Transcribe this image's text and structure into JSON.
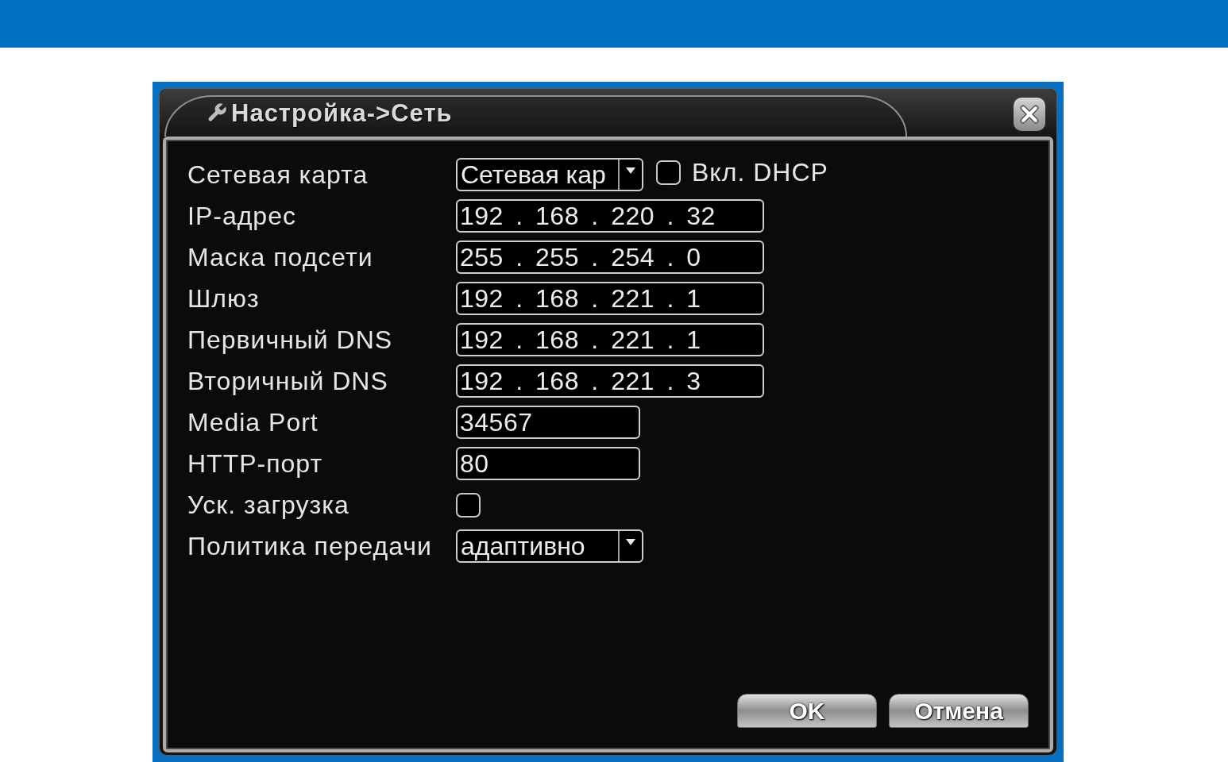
{
  "dialog": {
    "title": "Настройка->Сеть",
    "fields": [
      {
        "kind": "dropdown",
        "label": "Сетевая карта",
        "value": "Сетевая кар",
        "option": {
          "label": "Вкл. DHCP",
          "checked": false
        }
      },
      {
        "kind": "ip",
        "label": "IP-адрес",
        "value": "192 . 168 . 220 . 32"
      },
      {
        "kind": "ip",
        "label": "Маска подсети",
        "value": "255 . 255 . 254 . 0"
      },
      {
        "kind": "ip",
        "label": "Шлюз",
        "value": "192 . 168 . 221 . 1"
      },
      {
        "kind": "ip",
        "label": "Первичный DNS",
        "value": "192 . 168 . 221 . 1"
      },
      {
        "kind": "ip",
        "label": "Вторичный DNS",
        "value": "192 . 168 . 221 . 3"
      },
      {
        "kind": "text",
        "label": "Media Port",
        "value": "34567"
      },
      {
        "kind": "text",
        "label": "HTTP-порт",
        "value": "80"
      },
      {
        "kind": "checkbox",
        "label": "Уск. загрузка",
        "checked": false
      },
      {
        "kind": "dropdown",
        "label": "Политика передачи",
        "value": "адаптивно"
      }
    ],
    "buttons": [
      "OK",
      "Отмена"
    ]
  }
}
